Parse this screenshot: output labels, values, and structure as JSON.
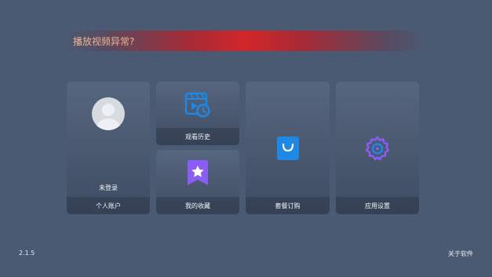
{
  "banner": {
    "text": "播放视频异常?"
  },
  "cards": {
    "account": {
      "status": "未登录",
      "label": "个人账户",
      "icon": "avatar-icon"
    },
    "history": {
      "label": "观看历史",
      "icon": "history-icon"
    },
    "favorites": {
      "label": "我的收藏",
      "icon": "favorites-icon"
    },
    "subscription": {
      "label": "套餐订购",
      "icon": "shopping-bag-icon"
    },
    "settings": {
      "label": "应用设置",
      "icon": "gear-icon"
    }
  },
  "footer": {
    "version": "2.1.5",
    "about": "关于软件"
  },
  "colors": {
    "background": "#4a5a72",
    "banner_red": "#d2262a",
    "banner_text": "#f2b38d",
    "icon_blue": "#1e88e5",
    "icon_purple": "#8b5cf6"
  }
}
